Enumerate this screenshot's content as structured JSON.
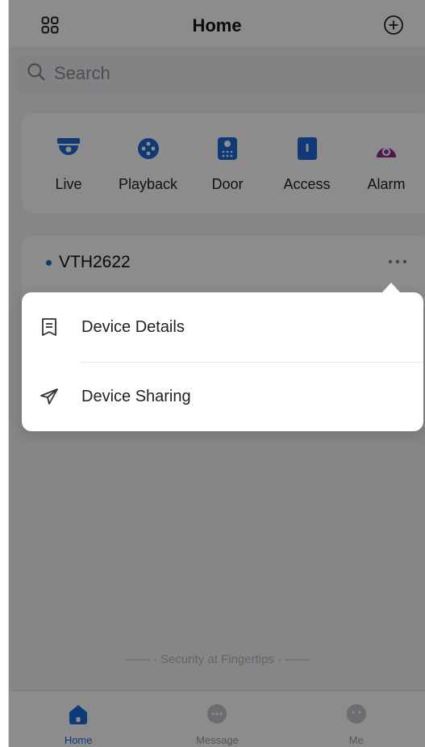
{
  "header": {
    "title": "Home"
  },
  "search": {
    "placeholder": "Search"
  },
  "quick_actions": [
    {
      "label": "Live",
      "icon": "camera-icon",
      "color": "#1e6bd6"
    },
    {
      "label": "Playback",
      "icon": "playback-icon",
      "color": "#1e6bd6"
    },
    {
      "label": "Door",
      "icon": "door-intercom-icon",
      "color": "#1e6bd6"
    },
    {
      "label": "Access",
      "icon": "access-control-icon",
      "color": "#1e6bd6"
    },
    {
      "label": "Alarm",
      "icon": "alarm-icon",
      "color": "#8e2a8e"
    }
  ],
  "device": {
    "name": "VTH2622",
    "status_color": "#1e6bd6"
  },
  "popup_menu": {
    "items": [
      {
        "label": "Device Details",
        "icon": "document-icon"
      },
      {
        "label": "Device Sharing",
        "icon": "send-icon"
      }
    ]
  },
  "footer": {
    "tagline": "—— · Security at Fingertips · ——"
  },
  "tabbar": {
    "tabs": [
      {
        "label": "Home",
        "icon": "home-icon",
        "active": true
      },
      {
        "label": "Message",
        "icon": "message-icon",
        "active": false
      },
      {
        "label": "Me",
        "icon": "user-icon",
        "active": false
      }
    ]
  },
  "colors": {
    "accent": "#1e6bd6",
    "overlay": "rgba(0,0,0,0.45)"
  }
}
